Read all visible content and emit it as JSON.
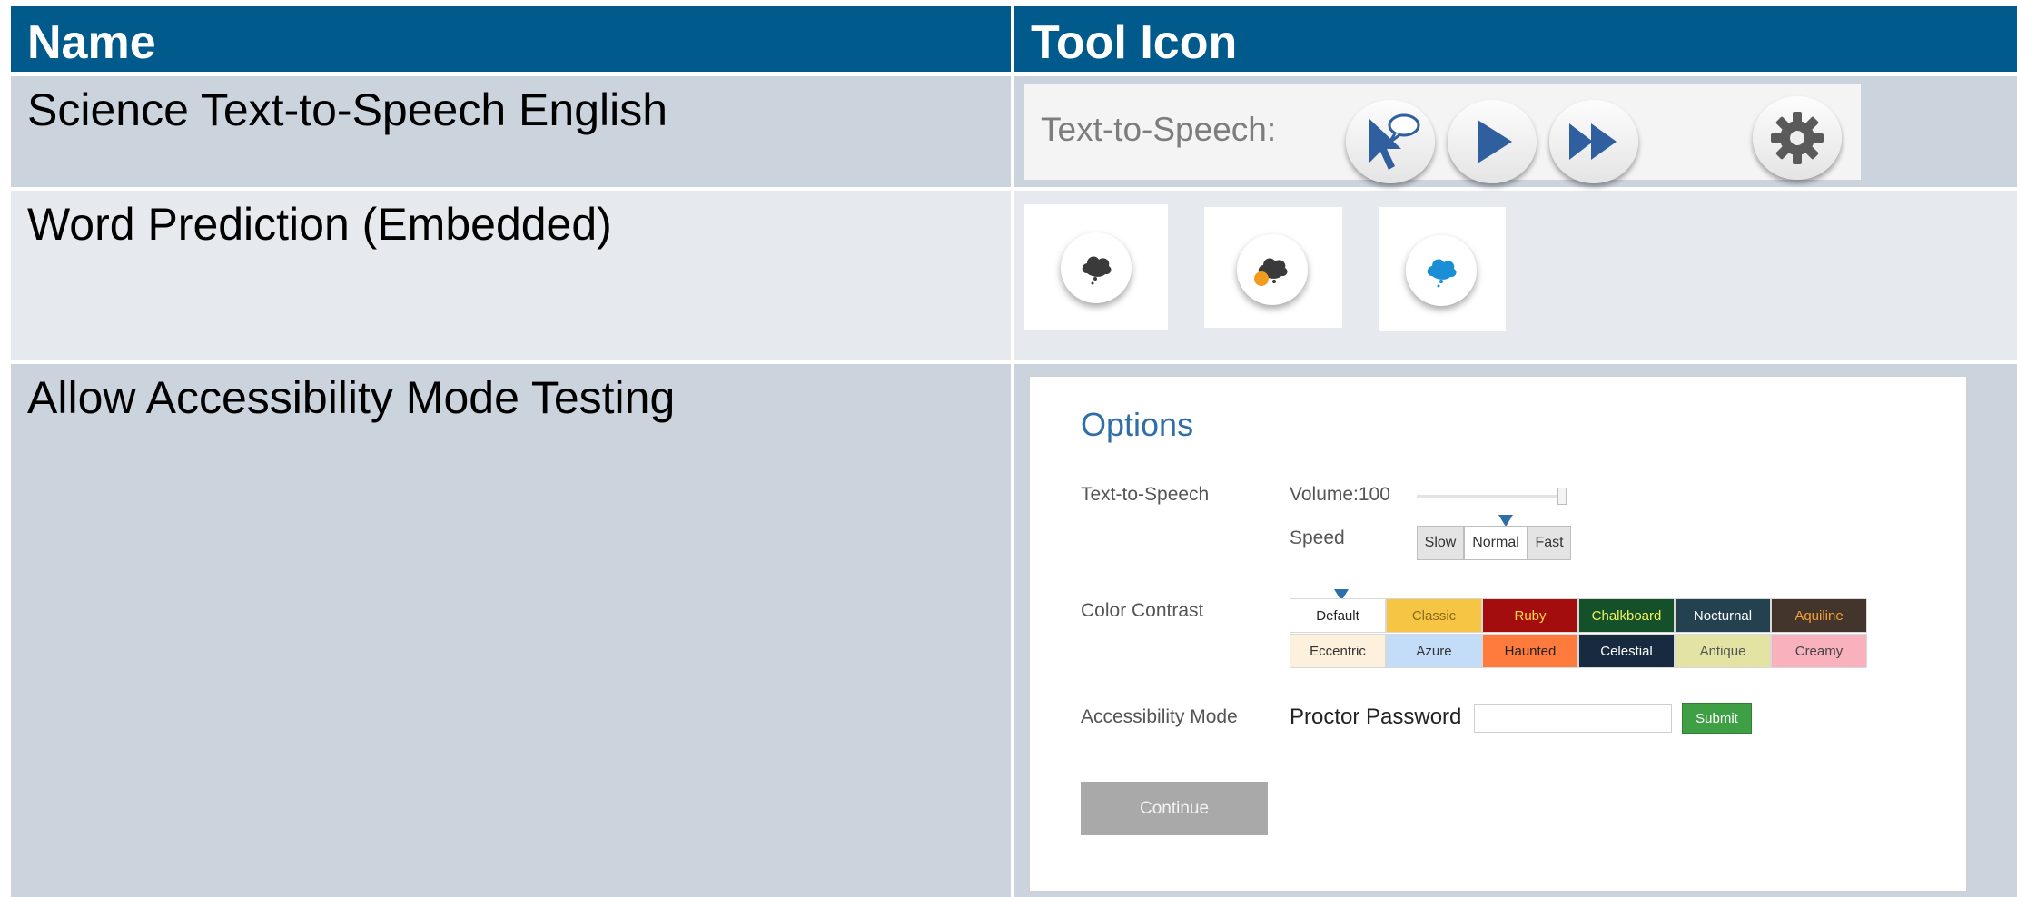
{
  "header": {
    "col1": "Name",
    "col2": "Tool Icon"
  },
  "rows": [
    {
      "name": "Science Text-to-Speech English"
    },
    {
      "name": "Word Prediction (Embedded)"
    },
    {
      "name": "Allow Accessibility Mode Testing"
    }
  ],
  "tts": {
    "label": "Text-to-Speech:",
    "buttons": [
      "select-icon",
      "play-icon",
      "fast-forward-icon",
      "gear-icon"
    ],
    "icon_color": "#2f5f9e"
  },
  "word_prediction": {
    "icons": [
      "cloud-dark-icon",
      "cloud-dark-orange-badge-icon",
      "cloud-blue-icon"
    ],
    "colors": {
      "dark": "#3a3a3a",
      "orange": "#f29c1f",
      "blue": "#1a8fd6"
    }
  },
  "options": {
    "title": "Options",
    "tts_label": "Text-to-Speech",
    "volume_label": "Volume:100",
    "volume_value": 100,
    "speed_label": "Speed",
    "speed_options": [
      "Slow",
      "Normal",
      "Fast"
    ],
    "speed_selected": "Normal",
    "contrast_label": "Color Contrast",
    "contrast_selected": "Default",
    "contrast_row1": [
      {
        "name": "Default",
        "bg": "#ffffff",
        "fg": "#222222"
      },
      {
        "name": "Classic",
        "bg": "#f7c544",
        "fg": "#8a6a1a"
      },
      {
        "name": "Ruby",
        "bg": "#a30d0d",
        "fg": "#ffd84a"
      },
      {
        "name": "Chalkboard",
        "bg": "#14502a",
        "fg": "#f3f35a"
      },
      {
        "name": "Nocturnal",
        "bg": "#24414f",
        "fg": "#ffffff"
      },
      {
        "name": "Aquiline",
        "bg": "#43342c",
        "fg": "#f2a23a"
      }
    ],
    "contrast_row2": [
      {
        "name": "Eccentric",
        "bg": "#fdf0dc",
        "fg": "#333333"
      },
      {
        "name": "Azure",
        "bg": "#c3dcf7",
        "fg": "#333333"
      },
      {
        "name": "Haunted",
        "bg": "#ff7a3d",
        "fg": "#222222"
      },
      {
        "name": "Celestial",
        "bg": "#172a40",
        "fg": "#ffffff"
      },
      {
        "name": "Antique",
        "bg": "#e3e3a3",
        "fg": "#555555"
      },
      {
        "name": "Creamy",
        "bg": "#f9b2bd",
        "fg": "#444444"
      }
    ],
    "accessibility_label": "Accessibility Mode",
    "proctor_label": "Proctor Password",
    "proctor_value": "",
    "submit_label": "Submit",
    "continue_label": "Continue"
  }
}
